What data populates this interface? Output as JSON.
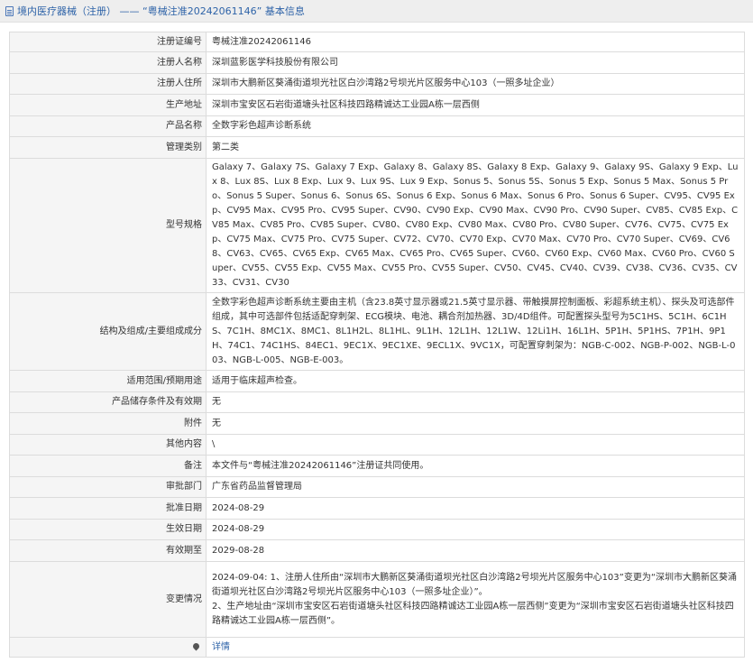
{
  "header": {
    "title": "境内医疗器械（注册） —— “粤械注准20242061146” 基本信息"
  },
  "rows": [
    {
      "label": "注册证编号",
      "value": "粤械注准20242061146"
    },
    {
      "label": "注册人名称",
      "value": "深圳蓝影医学科技股份有限公司"
    },
    {
      "label": "注册人住所",
      "value": "深圳市大鹏新区葵涌街道坝光社区白沙湾路2号坝光片区服务中心103（一照多址企业）"
    },
    {
      "label": "生产地址",
      "value": "深圳市宝安区石岩街道塘头社区科技四路精诚达工业园A栋一层西侧"
    },
    {
      "label": "产品名称",
      "value": "全数字彩色超声诊断系统"
    },
    {
      "label": "管理类别",
      "value": "第二类"
    },
    {
      "label": "型号规格",
      "value": "Galaxy 7、Galaxy 7S、Galaxy 7 Exp、Galaxy 8、Galaxy 8S、Galaxy 8 Exp、Galaxy 9、Galaxy 9S、Galaxy 9 Exp、Lux 8、Lux 8S、Lux 8 Exp、Lux 9、Lux 9S、Lux 9 Exp、Sonus 5、Sonus 5S、Sonus 5 Exp、Sonus 5 Max、Sonus 5 Pro、Sonus 5 Super、Sonus 6、Sonus 6S、Sonus 6 Exp、Sonus 6 Max、Sonus 6 Pro、Sonus 6 Super、CV95、CV95 Exp、CV95 Max、CV95 Pro、CV95 Super、CV90、CV90 Exp、CV90 Max、CV90 Pro、CV90 Super、CV85、CV85 Exp、CV85 Max、CV85 Pro、CV85 Super、CV80、CV80 Exp、CV80 Max、CV80 Pro、CV80 Super、CV76、CV75、CV75 Exp、CV75 Max、CV75 Pro、CV75 Super、CV72、CV70、CV70 Exp、CV70 Max、CV70 Pro、CV70 Super、CV69、CV68、CV63、CV65、CV65 Exp、CV65 Max、CV65 Pro、CV65 Super、CV60、CV60 Exp、CV60 Max、CV60 Pro、CV60 Super、CV55、CV55 Exp、CV55 Max、CV55 Pro、CV55 Super、CV50、CV45、CV40、CV39、CV38、CV36、CV35、CV33、CV31、CV30"
    },
    {
      "label": "结构及组成/主要组成成分",
      "value": "全数字彩色超声诊断系统主要由主机（含23.8英寸显示器或21.5英寸显示器、带触摸屏控制面板、彩超系统主机）、探头及可选部件组成，其中可选部件包括适配穿刺架、ECG模块、电池、耦合剂加热器、3D/4D组件。可配置探头型号为5C1HS、5C1H、6C1HS、7C1H、8MC1X、8MC1、8L1H2L、8L1HL、9L1H、12L1H、12L1W、12Li1H、16L1H、5P1H、5P1HS、7P1H、9P1H、74C1、74C1HS、84EC1、9EC1X、9EC1XE、9ECL1X、9VC1X，可配置穿刺架为：NGB-C-002、NGB-P-002、NGB-L-003、NGB-L-005、NGB-E-003。"
    },
    {
      "label": "适用范围/预期用途",
      "value": "适用于临床超声检查。"
    },
    {
      "label": "产品储存条件及有效期",
      "value": "无"
    },
    {
      "label": "附件",
      "value": "无"
    },
    {
      "label": "其他内容",
      "value": "\\"
    },
    {
      "label": "备注",
      "value": "本文件与“粤械注准20242061146”注册证共同使用。"
    },
    {
      "label": "审批部门",
      "value": "广东省药品监督管理局"
    },
    {
      "label": "批准日期",
      "value": "2024-08-29"
    },
    {
      "label": "生效日期",
      "value": "2024-08-29"
    },
    {
      "label": "有效期至",
      "value": "2029-08-28"
    },
    {
      "label": "变更情况",
      "value_lines": [
        "2024-09-04: 1、注册人住所由“深圳市大鹏新区葵涌街道坝光社区白沙湾路2号坝光片区服务中心103”变更为“深圳市大鹏新区葵涌街道坝光社区白沙湾路2号坝光片区服务中心103（一照多址企业）”。",
        "2、生产地址由“深圳市宝安区石岩街道塘头社区科技四路精诚达工业园A栋一层西侧”变更为“深圳市宝安区石岩街道塘头社区科技四路精诚达工业园A栋一层西侧”。"
      ]
    }
  ],
  "footer_row": {
    "label": "",
    "link": "详情",
    "icon": "location-pin-icon"
  }
}
